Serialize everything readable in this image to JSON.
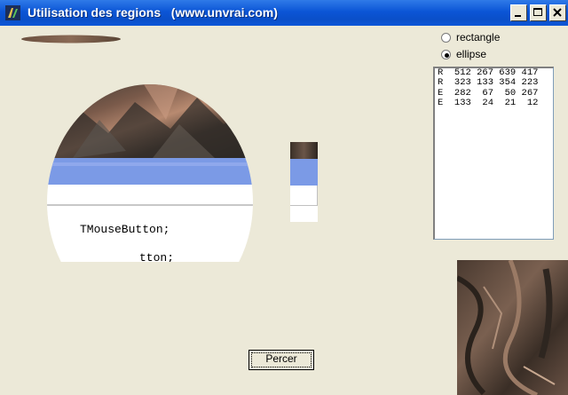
{
  "window": {
    "title": "Utilisation des regions   (www.unvrai.com)",
    "controls": [
      "minimize",
      "maximize",
      "close"
    ]
  },
  "options": {
    "rect_label": "rectangle",
    "ellipse_label": "ellipse",
    "selected": "ellipse"
  },
  "regions": {
    "rows": [
      "R  512 267 639 417",
      "R  323 133 354 223",
      "E  282  67  50 267",
      "E  133  24  21  12"
    ]
  },
  "code_text": {
    "line1": "TMouseButton;",
    "line2": "tton;"
  },
  "buttons": {
    "percer": "Percer"
  },
  "colors": {
    "titlebar": "#0b55d6",
    "face": "#ece9d8",
    "highlight": "#7b9ae6"
  }
}
